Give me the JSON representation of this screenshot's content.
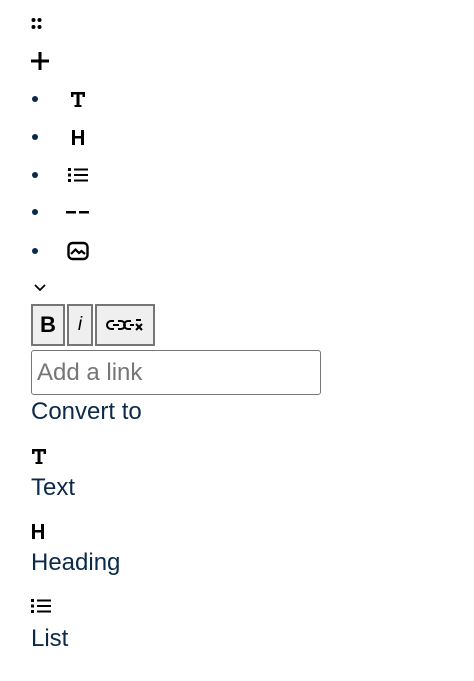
{
  "block_menu": {
    "drag_handle_icon": "drag-handle-icon",
    "add_icon": "plus-icon",
    "items": [
      {
        "name": "text",
        "icon": "text-icon"
      },
      {
        "name": "heading",
        "icon": "heading-icon"
      },
      {
        "name": "list",
        "icon": "list-icon"
      },
      {
        "name": "divider",
        "icon": "divider-icon"
      },
      {
        "name": "image",
        "icon": "image-icon"
      }
    ],
    "expand_icon": "chevron-down-icon"
  },
  "format_toolbar": {
    "bold_label": "B",
    "italic_label": "i",
    "unlink_icon": "unlink-icon"
  },
  "link_input": {
    "placeholder": "Add a link",
    "value": ""
  },
  "convert": {
    "title": "Convert to",
    "options": [
      {
        "label": "Text",
        "icon": "text-icon"
      },
      {
        "label": "Heading",
        "icon": "heading-icon"
      },
      {
        "label": "List",
        "icon": "list-icon"
      }
    ]
  },
  "colors": {
    "text_navy": "#0b2a4a",
    "button_bg": "#efefef",
    "button_border": "#767676"
  }
}
